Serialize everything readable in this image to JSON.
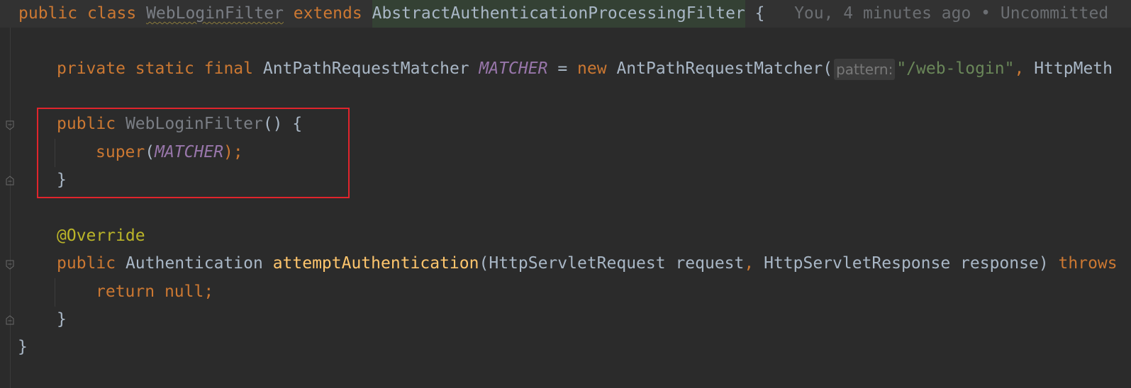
{
  "editor": {
    "line1": {
      "kw_public": "public",
      "kw_class": "class",
      "class_name": "WebLoginFilter",
      "kw_extends": "extends",
      "super_class": "AbstractAuthenticationProcessingFilter",
      "brace": "{",
      "blame": "You, 4 minutes ago • Uncommitted"
    },
    "line2": {
      "kw_private": "private",
      "kw_static": "static",
      "kw_final": "final",
      "type": "AntPathRequestMatcher",
      "field": "MATCHER",
      "eq": "=",
      "kw_new": "new",
      "ctor": "AntPathRequestMatcher(",
      "hint": "pattern:",
      "string": "\"/web-login\"",
      "comma": ",",
      "tail": "HttpMeth"
    },
    "line3": {
      "kw_public": "public",
      "name": "WebLoginFilter",
      "rest": "() {"
    },
    "line4": {
      "super": "super",
      "open": "(",
      "field": "MATCHER",
      "close": ");"
    },
    "line5": {
      "brace": "}"
    },
    "line6": {
      "annotation": "@Override"
    },
    "line7": {
      "kw_public": "public",
      "type": "Authentication",
      "method": "attemptAuthentication",
      "open": "(",
      "p1": "HttpServletRequest request",
      "comma": ",",
      "p2": "HttpServletResponse response)",
      "kw_throws": "throws"
    },
    "line8": {
      "kw_return": "return",
      "kw_null": "null",
      "semi": ";"
    },
    "line9": {
      "brace": "}"
    },
    "line10": {
      "brace": "}"
    }
  },
  "colors": {
    "background": "#2b2b2b",
    "keyword": "#cc7832",
    "static_field": "#9876aa",
    "string": "#6a8759",
    "annotation": "#bbb529",
    "method": "#ffc66d",
    "highlight_box": "#e0242c"
  }
}
